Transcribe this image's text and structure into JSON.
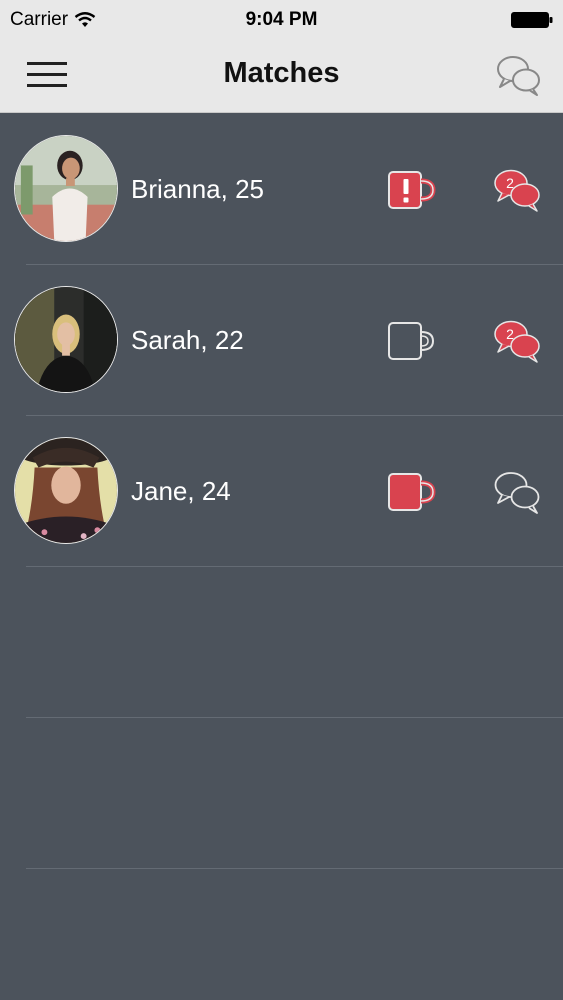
{
  "status_bar": {
    "carrier": "Carrier",
    "time": "9:04 PM"
  },
  "nav": {
    "title": "Matches",
    "menu_icon": "hamburger-menu-icon",
    "chats_icon": "chat-bubbles-icon"
  },
  "colors": {
    "accent": "#d9434f",
    "background": "#4c535c",
    "bar": "#e8e8e8",
    "outline": "#e6e6e6"
  },
  "matches": [
    {
      "name": "Brianna, 25",
      "mug": "alert",
      "unread": "2"
    },
    {
      "name": "Sarah, 22",
      "mug": "empty",
      "unread": "2"
    },
    {
      "name": "Jane, 24",
      "mug": "filled",
      "unread": ""
    }
  ]
}
